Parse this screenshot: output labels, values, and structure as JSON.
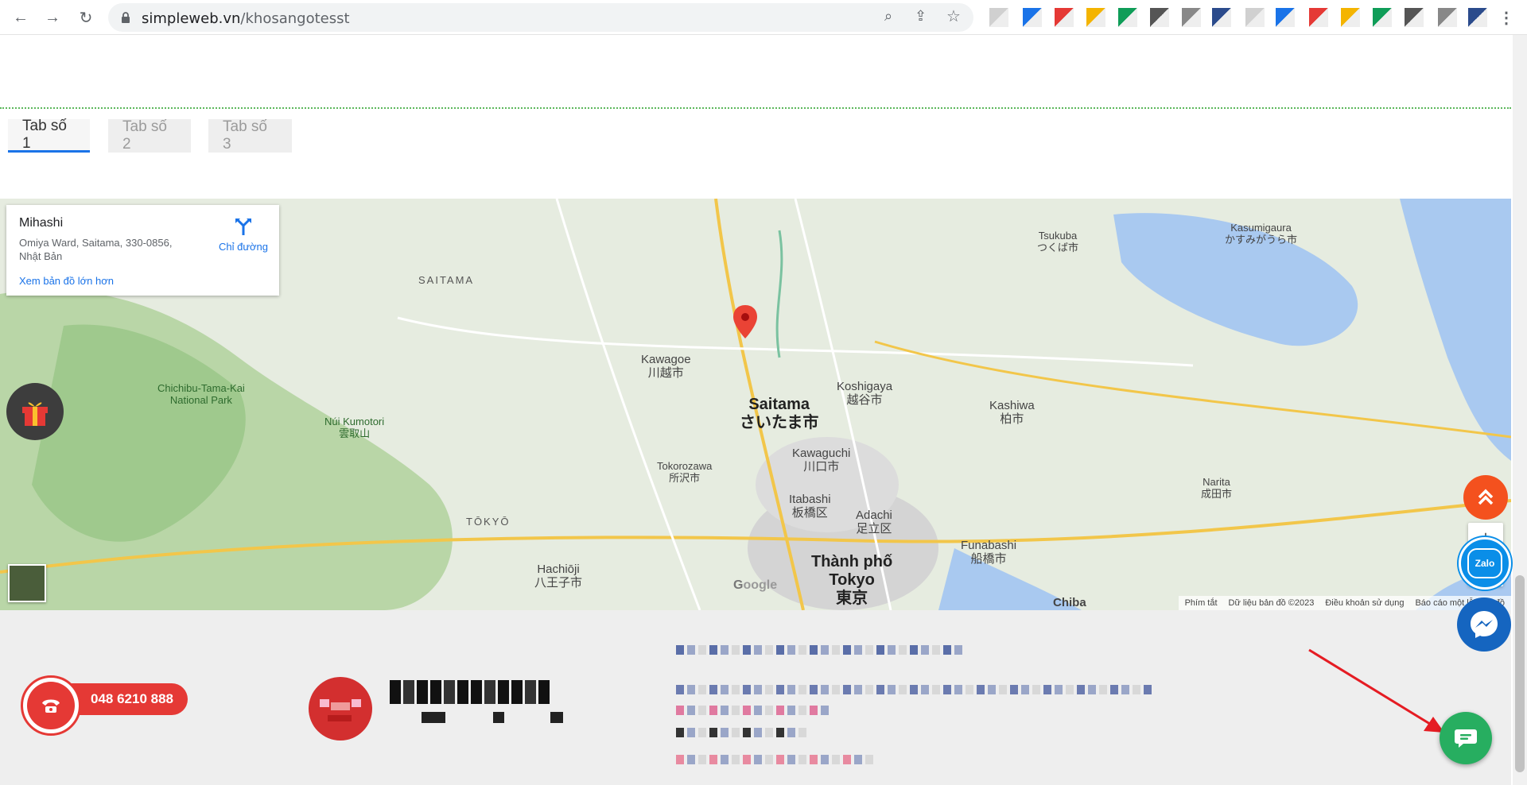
{
  "browser": {
    "url_host": "simpleweb.vn",
    "url_path": "/khosangotesst"
  },
  "tabs": [
    {
      "label": "Tab số 1",
      "active": true
    },
    {
      "label": "Tab số 2",
      "active": false
    },
    {
      "label": "Tab số 3",
      "active": false
    }
  ],
  "map": {
    "place_title": "Mihashi",
    "place_address": "Omiya Ward, Saitama, 330-0856, Nhật Bản",
    "directions_label": "Chỉ đường",
    "larger_map_link": "Xem bản đồ lớn hơn",
    "labels": {
      "saitama_en": "Saitama",
      "saitama_jp": "さいたま市",
      "tokyo_vi": "Thành phố",
      "tokyo_vi2": "Tokyo",
      "tokyo_jp": "東京",
      "kawagoe": "Kawagoe\n川越市",
      "koshigaya": "Koshigaya\n越谷市",
      "kawaguchi": "Kawaguchi\n川口市",
      "chichibu_park": "Chichibu-Tama-Kai\nNational Park",
      "saitama_region": "SAITAMA",
      "tokyo_region": "TŌKYŌ",
      "kasumigaura": "Kasumigaura\nかすみがうら市",
      "funabashi": "Funabashi\n船橋市",
      "hachioji": "Hachiōji\n八王子市",
      "adachi": "Adachi\n足立区",
      "itabashi": "Itabashi\n板橋区",
      "tokorozawa": "Tokorozawa\n所沢市",
      "chiba": "Chiba",
      "kashiwa": "Kashiwa\n柏市",
      "narita": "Narita\n成田市",
      "tsukuba": "Tsukuba\nつくば市",
      "kumotori": "Núi Kumotori\n雲取山"
    },
    "footer_links": [
      "Phím tắt",
      "Dữ liệu bản đồ ©2023",
      "Điều khoản sử dụng",
      "Báo cáo một lỗi bản đồ"
    ]
  },
  "footer": {
    "phone": "048 6210 888"
  },
  "floating": {
    "zalo_label": "Zalo"
  },
  "colors": {
    "tab_accent": "#1a73e8",
    "phone_red": "#e53935",
    "scroll_top_orange": "#f4511e",
    "zalo_blue": "#0a8ee8",
    "messenger_blue": "#1565c0",
    "chat_green": "#27ae60",
    "arrow_red": "#e51c23"
  }
}
